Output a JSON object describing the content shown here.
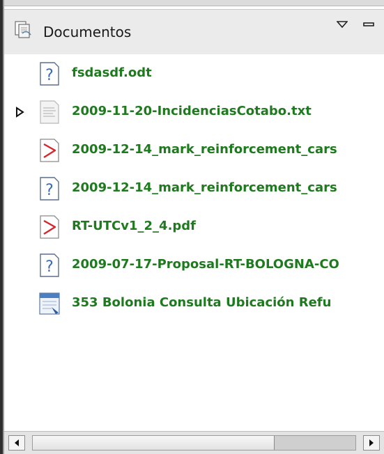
{
  "panel": {
    "title": "Documentos",
    "icon": "documents-icon",
    "menu_icon": "dropdown-triangle-icon",
    "minimize_icon": "minimize-icon"
  },
  "documents": [
    {
      "name": "fsdasdf.odt",
      "icon": "unknown-file-icon",
      "expandable": false
    },
    {
      "name": "2009-11-20-IncidenciasCotabo.txt",
      "icon": "text-file-icon",
      "expandable": true
    },
    {
      "name": "2009-12-14_mark_reinforcement_cars",
      "icon": "pdf-file-icon",
      "expandable": false
    },
    {
      "name": "2009-12-14_mark_reinforcement_cars",
      "icon": "unknown-file-icon",
      "expandable": false
    },
    {
      "name": "RT-UTCv1_2_4.pdf",
      "icon": "pdf-file-icon",
      "expandable": false
    },
    {
      "name": "2009-07-17-Proposal-RT-BOLOGNA-CO",
      "icon": "unknown-file-icon",
      "expandable": false
    },
    {
      "name": "353 Bolonia Consulta Ubicación Refu",
      "icon": "spreadsheet-file-icon",
      "expandable": false
    }
  ],
  "scrollbar": {
    "position": 0.0,
    "visible_fraction": 0.75
  },
  "colors": {
    "label": "#1f7a1f",
    "header_bg": "#ebebeb"
  }
}
